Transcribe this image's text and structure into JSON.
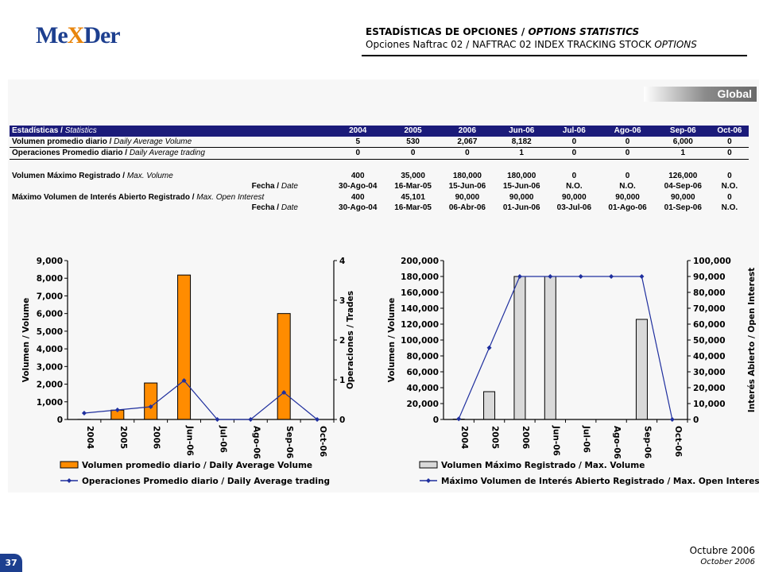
{
  "header": {
    "logo": {
      "part1": "Me",
      "part2": "X",
      "part3": "Der"
    },
    "title_es": "ESTADÍSTICAS DE OPCIONES / ",
    "title_en": "OPTIONS STATISTICS",
    "subtitle_a": "Opciones Naftrac 02 / NAFTRAC 02 INDEX TRACKING STOCK ",
    "subtitle_b": "OPTIONS"
  },
  "section_badge": "Global",
  "table": {
    "header_label_es": "Estadísticas / ",
    "header_label_en": "Statistics",
    "columns": [
      "2004",
      "2005",
      "2006",
      "Jun-06",
      "Jul-06",
      "Ago-06",
      "Sep-06",
      "Oct-06"
    ],
    "rows": [
      {
        "label_es": "Volumen promedio diario / ",
        "label_en": "Daily Average Volume",
        "align": "left",
        "values": [
          "5",
          "530",
          "2,067",
          "8,182",
          "0",
          "0",
          "6,000",
          "0"
        ]
      },
      {
        "label_es": "Operaciones Promedio diario / ",
        "label_en": "Daily Average trading",
        "align": "left",
        "values": [
          "0",
          "0",
          "0",
          "1",
          "0",
          "0",
          "1",
          "0"
        ]
      },
      {
        "label_es": "Volumen Máximo Registrado / ",
        "label_en": "Max. Volume",
        "align": "left",
        "values": [
          "400",
          "35,000",
          "180,000",
          "180,000",
          "0",
          "0",
          "126,000",
          "0"
        ]
      },
      {
        "label_es": "Fecha / ",
        "label_en": "Date",
        "align": "right",
        "values": [
          "30-Ago-04",
          "16-Mar-05",
          "15-Jun-06",
          "15-Jun-06",
          "N.O.",
          "N.O.",
          "04-Sep-06",
          "N.O."
        ]
      },
      {
        "label_es": "Máximo Volumen de Interés Abierto Registrado / ",
        "label_en": "Max. Open Interest",
        "align": "left",
        "values": [
          "400",
          "45,101",
          "90,000",
          "90,000",
          "90,000",
          "90,000",
          "90,000",
          "0"
        ]
      },
      {
        "label_es": "Fecha / ",
        "label_en": "Date",
        "align": "right",
        "values": [
          "30-Ago-04",
          "16-Mar-05",
          "06-Abr-06",
          "01-Jun-06",
          "03-Jul-06",
          "01-Ago-06",
          "01-Sep-06",
          "N.O."
        ]
      }
    ]
  },
  "chart_data": [
    {
      "type": "bar",
      "categories": [
        "2004",
        "2005",
        "2006",
        "Jun-06",
        "Jul-06",
        "Ago-06",
        "Sep-06",
        "Oct-06"
      ],
      "ylabel": "Volumen / Volume",
      "y2label": "Operaciones / Trades",
      "ylim": [
        0,
        9000
      ],
      "y2lim": [
        0,
        4
      ],
      "yticks": [
        "0",
        "1,000",
        "2,000",
        "3,000",
        "4,000",
        "5,000",
        "6,000",
        "7,000",
        "8,000",
        "9,000"
      ],
      "y2ticks": [
        "0",
        "1",
        "2",
        "3",
        "4"
      ],
      "grid": false,
      "legend_position": "bottom",
      "series": [
        {
          "name": "Volumen promedio diario / Daily Average Volume",
          "kind": "bar",
          "axis": "left",
          "color": "#ff8c00",
          "values": [
            5,
            530,
            2067,
            8182,
            0,
            0,
            6000,
            0
          ]
        },
        {
          "name": "Operaciones Promedio diario / Daily Average trading",
          "kind": "line",
          "axis": "right",
          "color": "#1f2f9e",
          "values": [
            0.16,
            0.24,
            0.32,
            0.98,
            0,
            0,
            0.68,
            0
          ]
        }
      ]
    },
    {
      "type": "bar",
      "categories": [
        "2004",
        "2005",
        "2006",
        "Jun-06",
        "Jul-06",
        "Ago-06",
        "Sep-06",
        "Oct-06"
      ],
      "ylabel": "Volumen / Volume",
      "y2label": "Interés Abierto / Open Interest",
      "ylim": [
        0,
        200000
      ],
      "y2lim": [
        0,
        100000
      ],
      "yticks": [
        "0",
        "20,000",
        "40,000",
        "60,000",
        "80,000",
        "100,000",
        "120,000",
        "140,000",
        "160,000",
        "180,000",
        "200,000"
      ],
      "y2ticks": [
        "0",
        "10,000",
        "20,000",
        "30,000",
        "40,000",
        "50,000",
        "60,000",
        "70,000",
        "80,000",
        "90,000",
        "100,000"
      ],
      "grid": false,
      "legend_position": "bottom",
      "series": [
        {
          "name": "Volumen Máximo Registrado / Max. Volume",
          "kind": "bar",
          "axis": "left",
          "color": "#d9d9d9",
          "values": [
            400,
            35000,
            180000,
            180000,
            0,
            0,
            126000,
            0
          ]
        },
        {
          "name": "Máximo Volumen de Interés Abierto Registrado / Max. Open Interest",
          "kind": "line",
          "axis": "right",
          "color": "#1f2f9e",
          "values": [
            400,
            45101,
            90000,
            90000,
            90000,
            90000,
            90000,
            0
          ]
        }
      ]
    }
  ],
  "footer": {
    "page_number": "37",
    "date_es": "Octubre 2006",
    "date_en": "October 2006"
  }
}
